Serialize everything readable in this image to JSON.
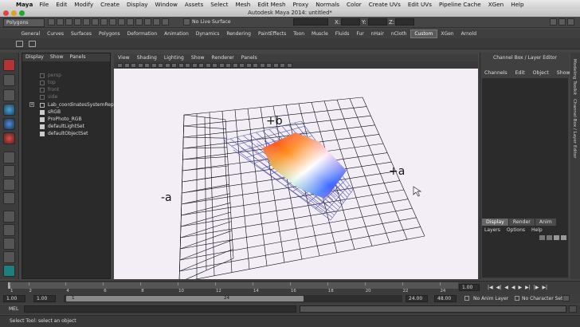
{
  "menubar": {
    "app": "Maya",
    "items": [
      "File",
      "Edit",
      "Modify",
      "Create",
      "Display",
      "Window",
      "Assets",
      "Select",
      "Mesh",
      "Edit Mesh",
      "Proxy",
      "Normals",
      "Color",
      "Create UVs",
      "Edit UVs",
      "Pipeline Cache",
      "XGen",
      "Help"
    ]
  },
  "window": {
    "title": "Autodesk Maya 2014: untitled*"
  },
  "statusline": {
    "menu_set": "Polygons",
    "live_surface": "No Live Surface",
    "x_label": "X:",
    "y_label": "Y:",
    "z_label": "Z:"
  },
  "shelf_tabs": [
    "General",
    "Curves",
    "Surfaces",
    "Polygons",
    "Deformation",
    "Animation",
    "Dynamics",
    "Rendering",
    "PaintEffects",
    "Toon",
    "Muscle",
    "Fluids",
    "Fur",
    "nHair",
    "nCloth",
    "Custom",
    "XGen",
    "Arnold"
  ],
  "active_shelf": "Custom",
  "outliner": {
    "menu": [
      "Display",
      "Show",
      "Panels"
    ],
    "items": [
      "persp",
      "top",
      "front",
      "side",
      "Lab_coordinatesSystemRep",
      "sRGB",
      "ProPhoto_RGB",
      "defaultLightSet",
      "defaultObjectSet"
    ]
  },
  "viewport": {
    "menu": [
      "View",
      "Shading",
      "Lighting",
      "Show",
      "Renderer",
      "Panels"
    ],
    "labels": {
      "plus_b": "+b",
      "plus_a": "+a",
      "minus_a": "-a"
    }
  },
  "channel_box": {
    "title": "Channel Box / Layer Editor",
    "menu": [
      "Channels",
      "Edit",
      "Object",
      "Show"
    ],
    "layer_tabs": [
      "Display",
      "Render",
      "Anim"
    ],
    "active_layer_tab": "Display",
    "layer_menu": [
      "Layers",
      "Options",
      "Help"
    ]
  },
  "side_tabs": [
    "Modeling Toolkit",
    "Channel Box / Layer Editor"
  ],
  "timeline": {
    "ticks": [
      "1",
      "2",
      "4",
      "6",
      "8",
      "10",
      "12",
      "14",
      "16",
      "18",
      "20",
      "22",
      "24"
    ],
    "current_frame": "1.00"
  },
  "range": {
    "start": "1.00",
    "start2": "1.00",
    "slider_left": "1",
    "slider_right": "24",
    "end": "24.00",
    "end2": "48.00",
    "anim_layer": "No Anim Layer",
    "character_set": "No Character Set"
  },
  "cmdline": {
    "label": "MEL"
  },
  "helpline": {
    "text": "Select Tool: select an object"
  },
  "colors": {
    "accent": "#d03a3a",
    "viewport_bg": "#f3edf6",
    "grid": "#0a0a14",
    "cage": "#3a3f9a"
  }
}
